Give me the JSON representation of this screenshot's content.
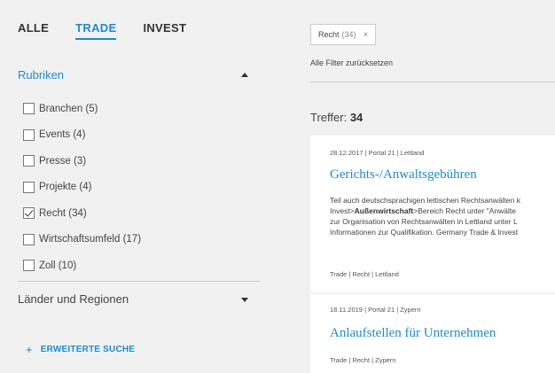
{
  "tabs": [
    {
      "label": "ALLE"
    },
    {
      "label": "TRADE"
    },
    {
      "label": "INVEST"
    }
  ],
  "rubriken": {
    "title": "Rubriken",
    "items": [
      {
        "label": "Branchen (5)",
        "checked": false
      },
      {
        "label": "Events (4)",
        "checked": false
      },
      {
        "label": "Presse (3)",
        "checked": false
      },
      {
        "label": "Projekte (4)",
        "checked": false
      },
      {
        "label": "Recht (34)",
        "checked": true
      },
      {
        "label": "Wirtschaftsumfeld (17)",
        "checked": false
      },
      {
        "label": "Zoll (10)",
        "checked": false
      }
    ]
  },
  "laender": {
    "title": "Länder und Regionen"
  },
  "advanced_search": {
    "plus": "+",
    "label": "ERWEITERTE SUCHE"
  },
  "active_filter": {
    "label": "Recht",
    "count": "(34)",
    "close": "×"
  },
  "reset_filters": "Alle Filter zurücksetzen",
  "results": {
    "prefix": "Treffer:",
    "count": "34"
  },
  "cards": [
    {
      "meta": "28.12.2017  |  Portal 21  |  Lettland",
      "title": "Gerichts-/Anwaltsgebühren",
      "text": [
        "Teil auch deutschsprachigen lettischen Rechtsanwälten k",
        "Invest>",
        "Außenwirtschaft",
        ">Bereich Recht unter \"Anwälte",
        "zur Organisation von Rechtsanwälten in Lettland unter L",
        "Informationen zur Qualifikation. Germany Trade & Invest"
      ],
      "tags": "Trade |  Recht |  Lettland"
    },
    {
      "meta": "18.11.2019  |  Portal 21  |  Zypern",
      "title": "Anlaufstellen für Unternehmen",
      "tags": "Trade |  Recht |  Zypern"
    }
  ],
  "colors": {
    "accent": "#1f8bc9",
    "background": "#f1f1f1",
    "card": "#ffffff"
  }
}
